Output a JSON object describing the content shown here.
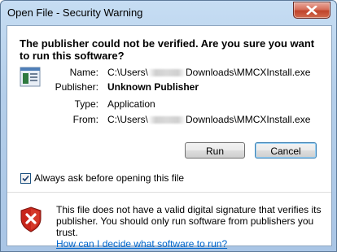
{
  "window": {
    "title": "Open File - Security Warning"
  },
  "dialog": {
    "heading": "The publisher could not be verified.  Are you sure you want to run this software?",
    "fields": {
      "name_label": "Name:",
      "name_prefix": "C:\\Users\\",
      "name_suffix": "Downloads\\MMCXInstall.exe",
      "publisher_label": "Publisher:",
      "publisher_value": "Unknown Publisher",
      "type_label": "Type:",
      "type_value": "Application",
      "from_label": "From:",
      "from_prefix": "C:\\Users\\",
      "from_suffix": "Downloads\\MMCXInstall.exe"
    },
    "buttons": {
      "run": "Run",
      "cancel": "Cancel"
    },
    "checkbox": {
      "label": "Always ask before opening this file",
      "checked": true
    },
    "warning": {
      "text": "This file does not have a valid digital signature that verifies its publisher.  You should only run software from publishers you trust.",
      "link": "How can I decide what software to run?"
    }
  },
  "icons": {
    "close": "close-icon",
    "file": "application-file-icon",
    "shield": "shield-error-icon",
    "check": "checkmark-icon"
  },
  "colors": {
    "title_gradient_top": "#c6ddf3",
    "title_gradient_bottom": "#a9c5e5",
    "close_red": "#c0442b",
    "link": "#0066cc",
    "shield_red": "#c8261b"
  }
}
